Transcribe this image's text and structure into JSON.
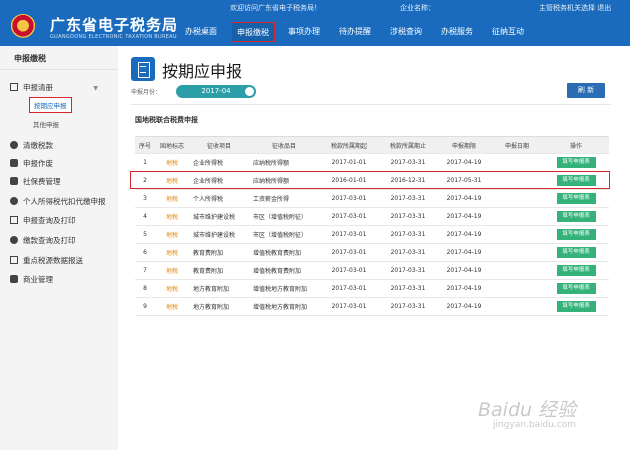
{
  "header": {
    "site_name": "广东省电子税务局",
    "site_name_en": "GUANGDONG ELECTRONIC TAXATION BUREAU",
    "welcome": "欢迎访问广东省电子税务局！",
    "company_label": "企业名称：",
    "user_info": "主管税务机关选择 退出",
    "nav": [
      "办税桌面",
      "申报缴税",
      "事项办理",
      "待办提醒",
      "涉税查询",
      "办税服务",
      "征纳互动"
    ],
    "active_nav": "申报缴税"
  },
  "sidebar": {
    "title": "申报缴税",
    "group": "申报清册",
    "sub_active": "按期应申报",
    "sub_other": "其他申报",
    "items": [
      "清缴税款",
      "申报作废",
      "社保费管理",
      "个人所得税代扣代缴申报",
      "申报查询及打印",
      "缴款查询及打印",
      "重点税源数据报送",
      "商业管理"
    ]
  },
  "main": {
    "page_title": "按期应申报",
    "period_label": "申报月份：",
    "period_value": "2017-04",
    "refresh_label": "刷 新",
    "section_title": "国地税联合税费申报"
  },
  "table": {
    "columns": [
      "序号",
      "国地标志",
      "征收项目",
      "征收品目",
      "税款所属期起",
      "税款所属期止",
      "申报期限",
      "申报日期",
      "操作"
    ],
    "rows": [
      {
        "no": "1",
        "tag": "地税",
        "item": "企业所得税",
        "sub": "应纳税所得额",
        "start": "2017-01-01",
        "end": "2017-03-31",
        "deadline": "2017-04-19",
        "date": "",
        "action": "填写申报表"
      },
      {
        "no": "2",
        "tag": "地税",
        "item": "企业所得税",
        "sub": "应纳税所得额",
        "start": "2016-01-01",
        "end": "2016-12-31",
        "deadline": "2017-05-31",
        "date": "",
        "action": "填写申报表"
      },
      {
        "no": "3",
        "tag": "地税",
        "item": "个人所得税",
        "sub": "工资薪金所得",
        "start": "2017-03-01",
        "end": "2017-03-31",
        "deadline": "2017-04-19",
        "date": "",
        "action": "填写申报表"
      },
      {
        "no": "4",
        "tag": "地税",
        "item": "城市维护建设税",
        "sub": "市区（增值税附征）",
        "start": "2017-03-01",
        "end": "2017-03-31",
        "deadline": "2017-04-19",
        "date": "",
        "action": "填写申报表"
      },
      {
        "no": "5",
        "tag": "地税",
        "item": "城市维护建设税",
        "sub": "市区（增值税附征）",
        "start": "2017-03-01",
        "end": "2017-03-31",
        "deadline": "2017-04-19",
        "date": "",
        "action": "填写申报表"
      },
      {
        "no": "6",
        "tag": "地税",
        "item": "教育费附加",
        "sub": "增值税教育费附加",
        "start": "2017-03-01",
        "end": "2017-03-31",
        "deadline": "2017-04-19",
        "date": "",
        "action": "填写申报表"
      },
      {
        "no": "7",
        "tag": "地税",
        "item": "教育费附加",
        "sub": "增值税教育费附加",
        "start": "2017-03-01",
        "end": "2017-03-31",
        "deadline": "2017-04-19",
        "date": "",
        "action": "填写申报表"
      },
      {
        "no": "8",
        "tag": "地税",
        "item": "地方教育附加",
        "sub": "增值税地方教育附加",
        "start": "2017-03-01",
        "end": "2017-03-31",
        "deadline": "2017-04-19",
        "date": "",
        "action": "填写申报表"
      },
      {
        "no": "9",
        "tag": "地税",
        "item": "地方教育附加",
        "sub": "增值税地方教育附加",
        "start": "2017-03-01",
        "end": "2017-03-31",
        "deadline": "2017-04-19",
        "date": "",
        "action": "填写申报表"
      }
    ]
  },
  "watermark": {
    "main": "Baidu 经验",
    "sub": "jingyan.baidu.com"
  },
  "colors": {
    "header_blue": "#1a6bbd",
    "highlight_red": "#d9232d",
    "action_green": "#35b27a",
    "tag_orange": "#e8890a",
    "period_teal": "#2b9ea8"
  },
  "icons": [
    "emblem-icon",
    "document-icon",
    "chevron-down-icon"
  ]
}
